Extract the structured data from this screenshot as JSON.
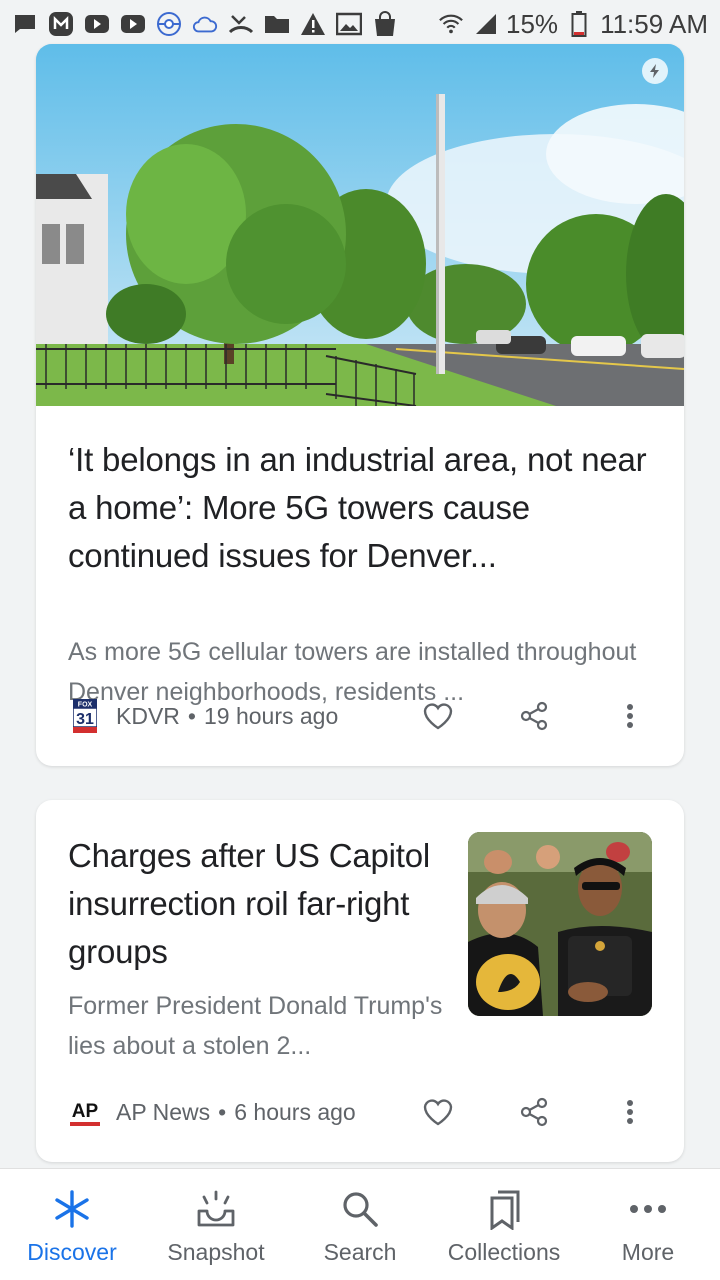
{
  "status_bar": {
    "battery": "15%",
    "time": "11:59 AM",
    "icons": [
      "message-icon",
      "m-app-icon",
      "youtube-icon",
      "youtube-icon",
      "pokeball-icon",
      "cloud-icon",
      "missed-call-icon",
      "folder-icon",
      "warning-icon",
      "image-icon",
      "shopping-bag-icon",
      "wifi-icon",
      "signal-icon",
      "battery-icon"
    ]
  },
  "cards": [
    {
      "title": "‘It belongs in an industrial area, not near a home’: More 5G towers cause continued issues for Denver...",
      "snippet": "As more 5G cellular towers are installed throughout Denver neighborhoods, residents ...",
      "source": "KDVR",
      "time": "19 hours ago",
      "logo_text_top": "FOX",
      "logo_text_num": "31",
      "image_icon": "amp-lightning-icon"
    },
    {
      "title": "Charges after US Capitol insurrection roil far-right groups",
      "snippet": "Former President Donald Trump's lies about a stolen 2...",
      "source": "AP News",
      "time": "6 hours ago",
      "logo_text": "AP"
    }
  ],
  "dot": "•",
  "bottom_nav": {
    "items": [
      {
        "label": "Discover",
        "icon": "asterisk-icon",
        "active": true
      },
      {
        "label": "Snapshot",
        "icon": "snapshot-icon",
        "active": false
      },
      {
        "label": "Search",
        "icon": "search-icon",
        "active": false
      },
      {
        "label": "Collections",
        "icon": "bookmarks-icon",
        "active": false
      },
      {
        "label": "More",
        "icon": "more-horiz-icon",
        "active": false
      }
    ]
  },
  "colors": {
    "accent": "#1a73e8",
    "title_text": "#202124",
    "secondary_text": "#70757a",
    "ap_red": "#d32f2f",
    "background": "#f1f3f4"
  }
}
